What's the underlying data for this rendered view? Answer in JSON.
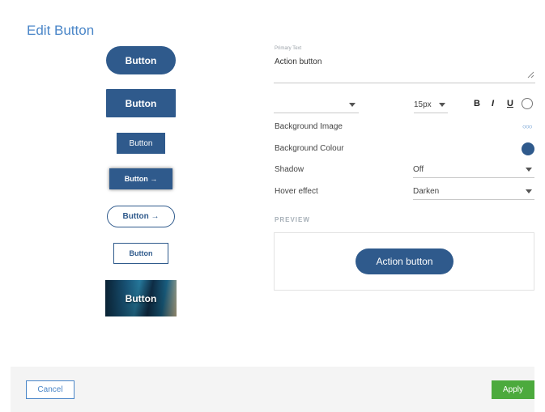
{
  "dialog": {
    "title": "Edit Button"
  },
  "presets": [
    {
      "label": "Button"
    },
    {
      "label": "Button"
    },
    {
      "label": "Button"
    },
    {
      "label": "Button →"
    },
    {
      "label": "Button →"
    },
    {
      "label": "Button"
    },
    {
      "label": "Button"
    }
  ],
  "text_field": {
    "label": "Primary Text",
    "value": "Action button"
  },
  "font": {
    "family_value": "",
    "size_value": "15px",
    "bold_label": "B",
    "italic_label": "I",
    "underline_label": "U"
  },
  "rows": {
    "background_image": {
      "label": "Background Image",
      "icon": "more-dots-icon",
      "dots": "○○○"
    },
    "background_colour": {
      "label": "Background Colour",
      "color": "#2f5a8c"
    },
    "shadow": {
      "label": "Shadow",
      "value": "Off"
    },
    "hover": {
      "label": "Hover effect",
      "value": "Darken"
    }
  },
  "preview": {
    "label": "PREVIEW",
    "button_label": "Action button"
  },
  "footer": {
    "cancel_label": "Cancel",
    "apply_label": "Apply"
  },
  "colors": {
    "accent": "#4a86c8",
    "button": "#2f5a8c",
    "apply": "#4caa3d"
  }
}
